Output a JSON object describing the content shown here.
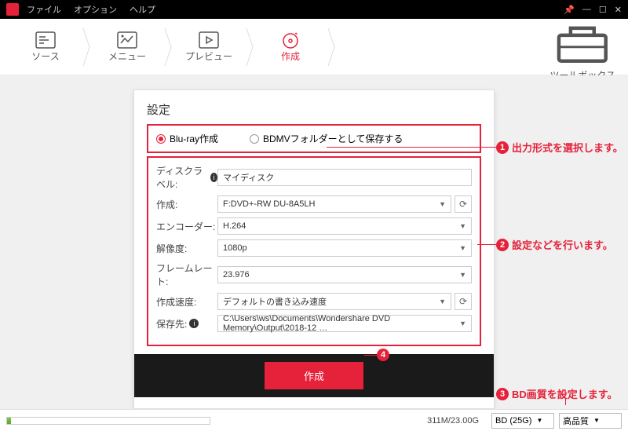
{
  "menubar": {
    "file": "ファイル",
    "options": "オプション",
    "help": "ヘルプ"
  },
  "tabs": {
    "source": "ソース",
    "menu": "メニュー",
    "preview": "プレビュー",
    "create": "作成",
    "toolbox": "ツールボックス"
  },
  "panel": {
    "title": "設定",
    "radio1": "Blu-ray作成",
    "radio2": "BDMVフォルダーとして保存する",
    "labels": {
      "disclabel": "ディスクラベル:",
      "create": "作成:",
      "encoder": "エンコーダー:",
      "resolution": "解像度:",
      "framerate": "フレームレート:",
      "speed": "作成速度:",
      "dest": "保存先:"
    },
    "values": {
      "disclabel": "マイディスク",
      "create": "F:DVD+-RW DU-8A5LH",
      "encoder": "H.264",
      "resolution": "1080p",
      "framerate": "23.976",
      "speed": "デフォルトの書き込み速度",
      "dest": "C:\\Users\\ws\\Documents\\Wondershare DVD Memory\\Output\\2018-12 …"
    },
    "create_btn": "作成"
  },
  "status": {
    "size": "311M/23.00G",
    "disc_type": "BD (25G)",
    "quality": "高品質"
  },
  "annotations": {
    "a1": "出力形式を選択します。",
    "a2": "設定などを行います。",
    "a3": "BD画質を設定します。",
    "n4": "4"
  }
}
